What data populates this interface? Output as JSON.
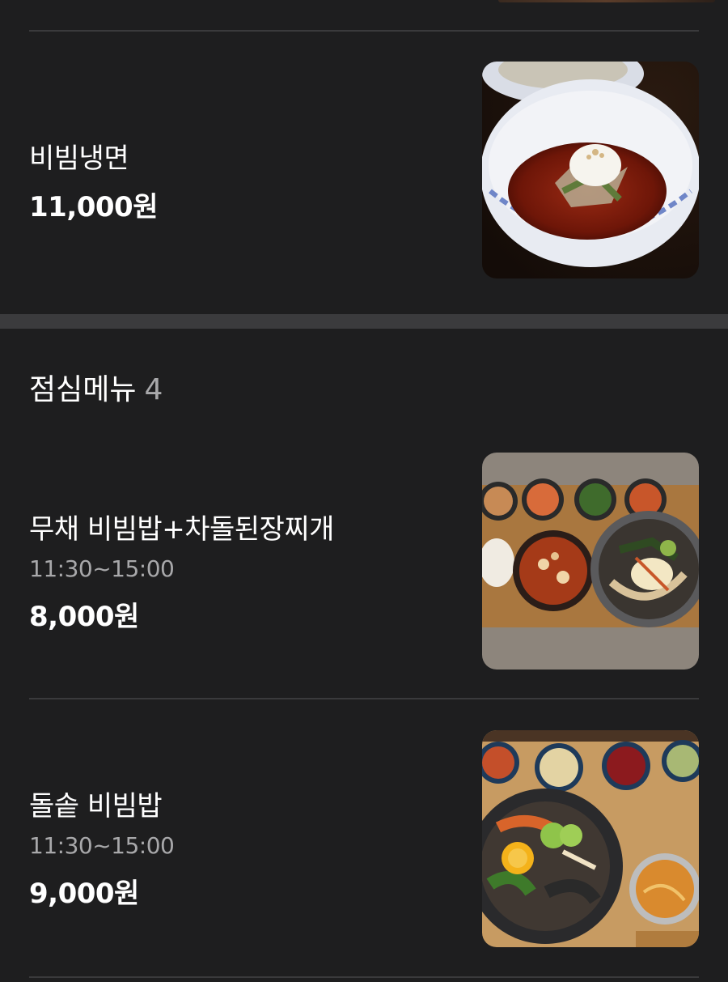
{
  "menu_top": {
    "items": [
      {
        "name": "비빔냉면",
        "price": "11,000원",
        "image": "bibim-naengmyeon-photo"
      }
    ]
  },
  "lunch_section": {
    "title": "점심메뉴",
    "count": "4",
    "items": [
      {
        "name": "무채 비빔밥+차돌된장찌개",
        "time": "11:30~15:00",
        "price": "8,000원",
        "image": "muchae-bibimbap-set-photo"
      },
      {
        "name": "돌솥 비빔밥",
        "time": "11:30~15:00",
        "price": "9,000원",
        "image": "dolsot-bibimbap-photo"
      }
    ]
  },
  "colors": {
    "background": "#1e1e1f",
    "divider": "#3a3a3c",
    "section_gap": "#3b3b3d",
    "muted_text": "#a8a8aa"
  }
}
